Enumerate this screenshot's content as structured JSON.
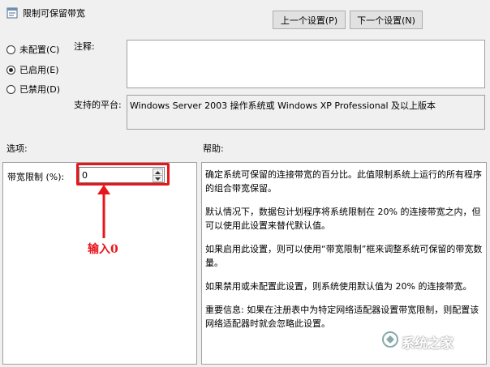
{
  "window": {
    "title": "限制可保留带宽"
  },
  "nav": {
    "prev_label": "上一个设置(P)",
    "next_label": "下一个设置(N)"
  },
  "state": {
    "options": [
      {
        "label": "未配置(C)",
        "checked": false
      },
      {
        "label": "已启用(E)",
        "checked": true
      },
      {
        "label": "已禁用(D)",
        "checked": false
      }
    ]
  },
  "comment": {
    "label": "注释:",
    "value": ""
  },
  "platform": {
    "label": "支持的平台:",
    "value": "Windows Server 2003 操作系统或 Windows XP Professional 及以上版本"
  },
  "sections": {
    "options_label": "选项:",
    "help_label": "帮助:"
  },
  "options": {
    "bandwidth_label": "带宽限制 (%):",
    "bandwidth_value": "0"
  },
  "help": {
    "paragraphs": [
      "确定系统可保留的连接带宽的百分比。此值限制系统上运行的所有程序的组合带宽保留。",
      "默认情况下，数据包计划程序将系统限制在 20% 的连接带宽之内，但可以使用此设置来替代默认值。",
      "如果启用此设置，则可以使用“带宽限制”框来调整系统可保留的带宽数量。",
      "如果禁用或未配置此设置，则系统使用默认值为 20% 的连接带宽。",
      "重要信息: 如果在注册表中为特定网络适配器设置带宽限制，则配置该网络适配器时就会忽略此设置。"
    ]
  },
  "annotation": {
    "text": "输入0",
    "color": "#e8151b"
  },
  "watermark": {
    "text": "系统之家"
  }
}
